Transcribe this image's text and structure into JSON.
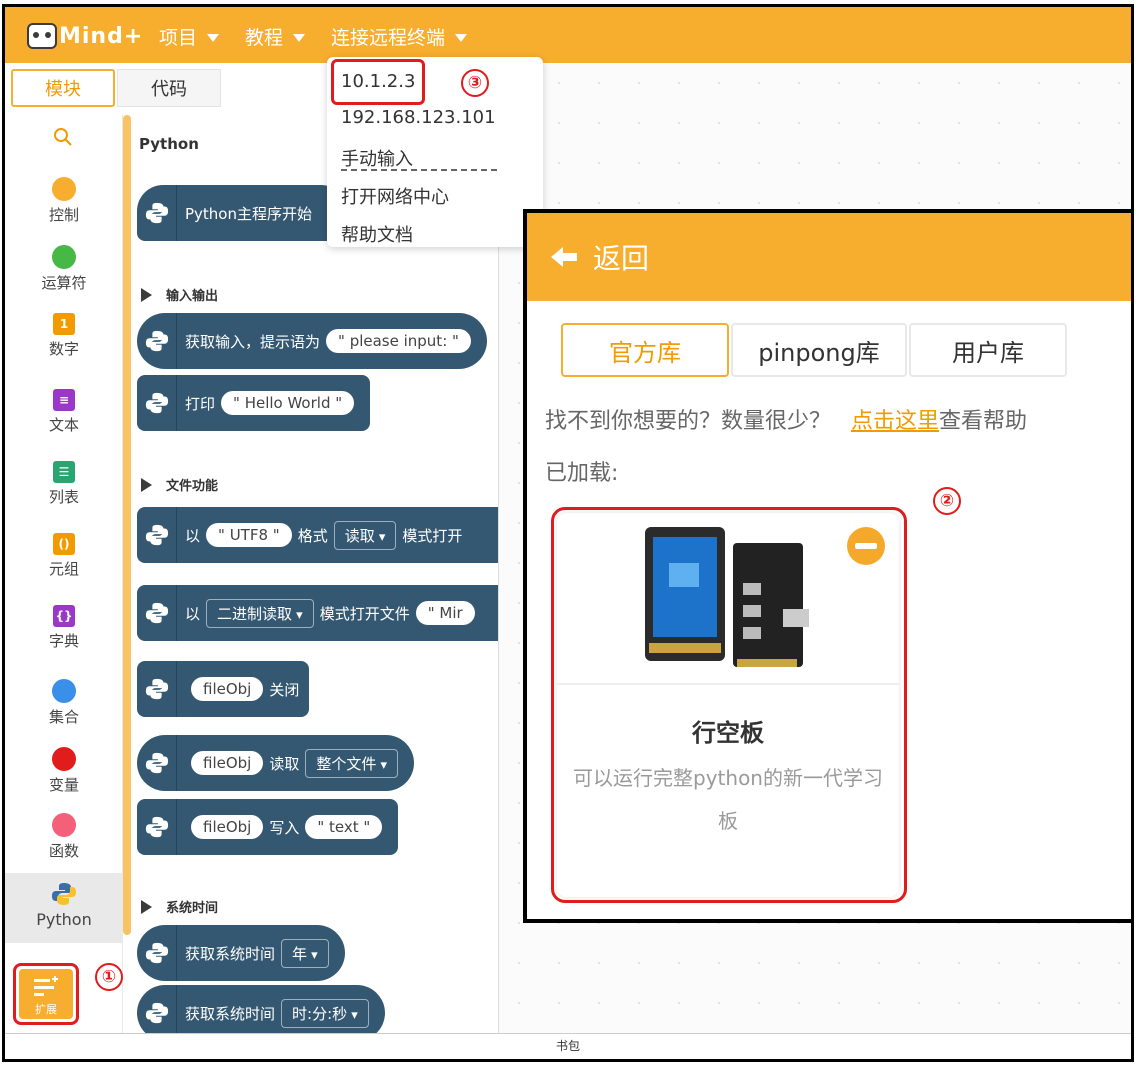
{
  "topbar": {
    "logo_text": "Mind+",
    "menus": [
      {
        "label": "项目"
      },
      {
        "label": "教程"
      },
      {
        "label": "连接远程终端"
      }
    ]
  },
  "tabs": {
    "blocks": "模块",
    "code": "代码"
  },
  "sidebar": {
    "categories": [
      {
        "label": "控制",
        "color": "#f7ad2e"
      },
      {
        "label": "运算符",
        "color": "#46b846"
      },
      {
        "label": "数字",
        "color": "#f29b00"
      },
      {
        "label": "文本",
        "color": "#9b37c9"
      },
      {
        "label": "列表",
        "color": "#2aa572"
      },
      {
        "label": "元组",
        "color": "#f29b00"
      },
      {
        "label": "字典",
        "color": "#9b37c9"
      },
      {
        "label": "集合",
        "color": "#3a8fe8"
      },
      {
        "label": "变量",
        "color": "#e01c1c"
      },
      {
        "label": "函数",
        "color": "#f4607a"
      },
      {
        "label": "Python",
        "color": "#3b6ea5"
      }
    ],
    "extension_label": "扩展"
  },
  "palette": {
    "section_title": "Python",
    "main_block": "Python主程序开始",
    "io_head": "输入输出",
    "input_block": {
      "text": "获取输入，提示语为",
      "chip": "please input:"
    },
    "print_block": {
      "text": "打印",
      "chip": "Hello World"
    },
    "file_head": "文件功能",
    "open_block": {
      "prefix": "以",
      "chip": "UTF8",
      "fmt": "格式",
      "mode": "读取",
      "suffix": "模式打开"
    },
    "open_bin_block": {
      "prefix": "以",
      "mode": "二进制读取",
      "suffix": "模式打开文件",
      "chip": "Mir"
    },
    "close_block": {
      "chip": "fileObj",
      "text": "关闭"
    },
    "read_block": {
      "chip": "fileObj",
      "text": "读取",
      "mode": "整个文件"
    },
    "write_block": {
      "chip": "fileObj",
      "text": "写入",
      "value": "text"
    },
    "time_head": "系统时间",
    "time_block1": {
      "text": "获取系统时间",
      "mode": "年"
    },
    "time_block2": {
      "text": "获取系统时间",
      "mode": "时:分:秒"
    }
  },
  "dropdown": {
    "items": [
      "10.1.2.3",
      "192.168.123.101",
      "手动输入",
      "打开网络中心",
      "帮助文档"
    ]
  },
  "badges": {
    "one": "①",
    "two": "②",
    "three": "③"
  },
  "ext_panel": {
    "back_label": "返回",
    "lib_tabs": [
      "官方库",
      "pinpong库",
      "用户库"
    ],
    "help_text": "找不到你想要的？数量很少？",
    "help_link": "点击这里",
    "help_suffix": "查看帮助",
    "loaded_label": "已加载:",
    "card": {
      "title": "行空板",
      "desc": "可以运行完整python的新一代学习板"
    }
  },
  "bottombar": {
    "label": "书包"
  },
  "colors": {
    "accent": "#f7ad2e",
    "block": "#355872",
    "highlight": "#e01c1c"
  }
}
